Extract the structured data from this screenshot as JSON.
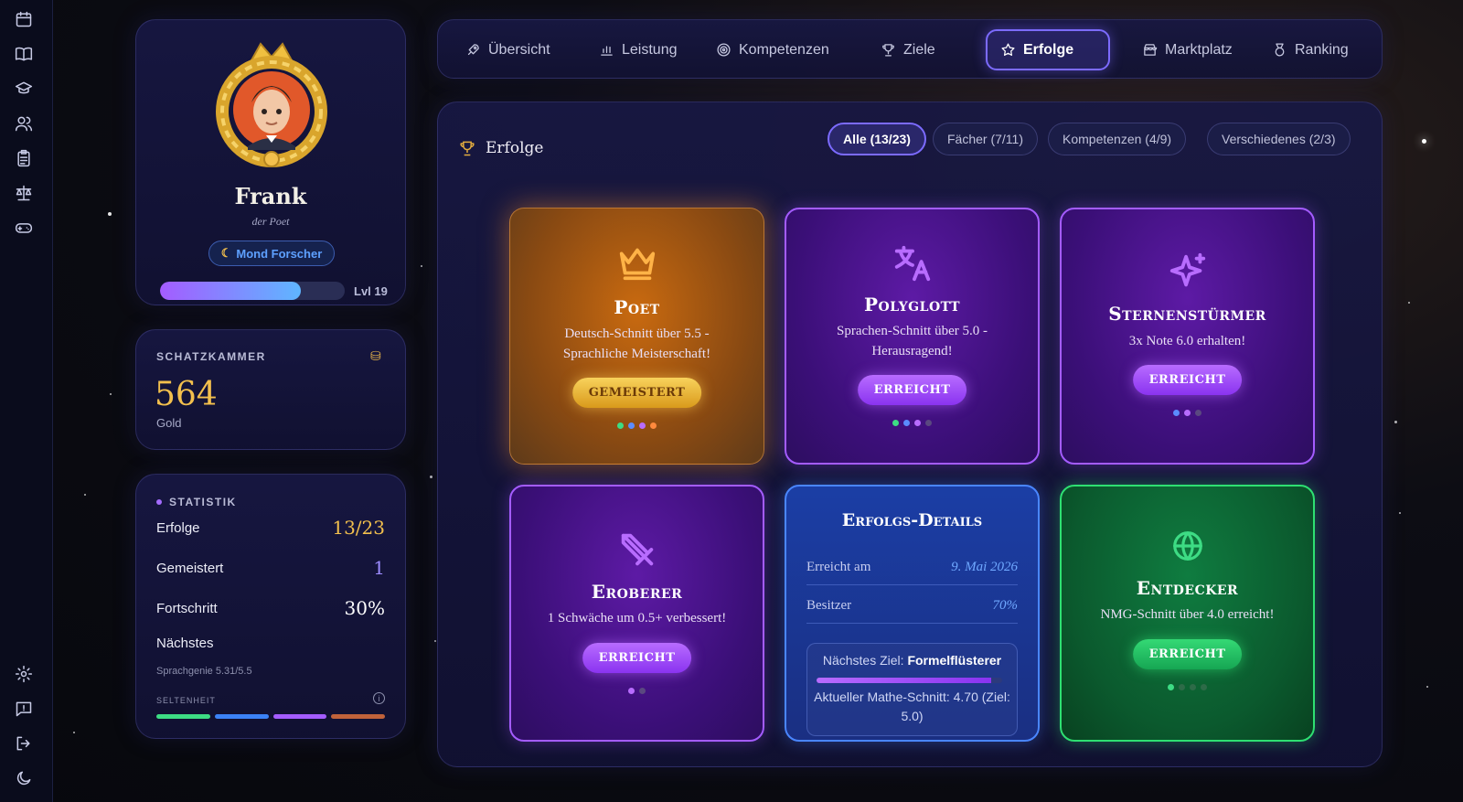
{
  "profile": {
    "name": "Frank",
    "title": "der Poet",
    "badge": "Mond Forscher",
    "badge_icon": "moon-icon",
    "level": "Lvl 19",
    "xp_fraction": 0.76
  },
  "treasury": {
    "label": "SCHATZKAMMER",
    "amount": "564",
    "unit": "Gold"
  },
  "stats": {
    "label": "STATISTIK",
    "rows": [
      {
        "key": "Erfolge",
        "value": "13/23",
        "color": "#f3c04d"
      },
      {
        "key": "Gemeistert",
        "value": "1",
        "color": "#9d8cff"
      },
      {
        "key": "Fortschritt",
        "value": "30%",
        "color": "#ffffff"
      }
    ],
    "next_label": "Nächstes",
    "next_sub": "Sprachgenie 5.31/5.5",
    "rarity_label": "SELTENHEIT",
    "rarity_colors": [
      "#3ddc84",
      "#3b82f6",
      "#a45cff",
      "#c0623a"
    ]
  },
  "tabs": [
    {
      "label": "Übersicht",
      "icon": "rocket-icon"
    },
    {
      "label": "Leistung",
      "icon": "bar-chart-icon"
    },
    {
      "label": "Kompetenzen",
      "icon": "target-icon"
    },
    {
      "label": "Ziele",
      "icon": "trophy-icon"
    },
    {
      "label": "Erfolge",
      "icon": "star-icon"
    },
    {
      "label": "Marktplatz",
      "icon": "store-icon"
    },
    {
      "label": "Ranking",
      "icon": "medal-icon"
    }
  ],
  "main": {
    "title": "Erfolge",
    "filters": [
      "Alle (13/23)",
      "Fächer (7/11)",
      "Kompetenzen (4/9)",
      "Verschiedenes (2/3)"
    ]
  },
  "cards": [
    {
      "title": "Poet",
      "desc": "Deutsch-Schnitt über 5.5 - Sprachliche Meisterschaft!",
      "button": "GEMEISTERT",
      "icon": "crown-icon"
    },
    {
      "title": "Polyglott",
      "desc": "Sprachen-Schnitt über 5.0 - Herausragend!",
      "button": "ERREICHT",
      "icon": "translate-icon"
    },
    {
      "title": "Sternenstürmer",
      "desc": "3x Note 6.0 erhalten!",
      "button": "ERREICHT",
      "icon": "sparkle-icon"
    },
    {
      "title": "Eroberer",
      "desc": "1 Schwäche um 0.5+ verbessert!",
      "button": "ERREICHT",
      "icon": "sword-icon"
    },
    {
      "title": "Entdecker",
      "desc": "NMG-Schnitt über 4.0 erreicht!",
      "button": "ERREICHT",
      "icon": "globe-icon"
    }
  ],
  "details": {
    "title": "Erfolgs-Details",
    "reached_key": "Erreicht am",
    "reached_val": "9. Mai 2026",
    "owners_key": "Besitzer",
    "owners_val": "70%",
    "next_prefix": "Nächstes Ziel:",
    "next_goal": "Formelflüsterer",
    "next_progress": 0.94,
    "next_info": "Aktueller Mathe-Schnitt: 4.70 (Ziel: 5.0)"
  }
}
